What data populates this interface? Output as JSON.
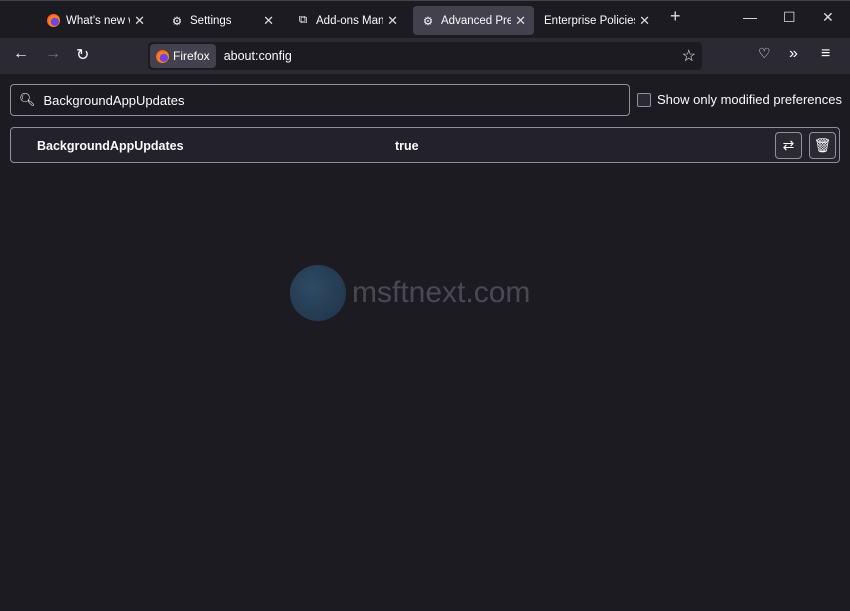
{
  "tabs": [
    {
      "label": "What's new with",
      "icon": "firefox-icon"
    },
    {
      "label": "Settings",
      "icon": "gear-icon"
    },
    {
      "label": "Add-ons Manag",
      "icon": "puzzle-icon"
    },
    {
      "label": "Advanced Prefer",
      "icon": "gear-icon",
      "active": true
    },
    {
      "label": "Enterprise Policies",
      "icon": ""
    }
  ],
  "toolbar": {
    "identity": "Firefox",
    "url": "about:config"
  },
  "search": {
    "value": "BackgroundAppUpdates"
  },
  "modified_only": {
    "label": "Show only modified preferences",
    "checked": false
  },
  "prefs": [
    {
      "name": "BackgroundAppUpdates",
      "value": "true"
    }
  ],
  "watermark": "msftnext.com"
}
